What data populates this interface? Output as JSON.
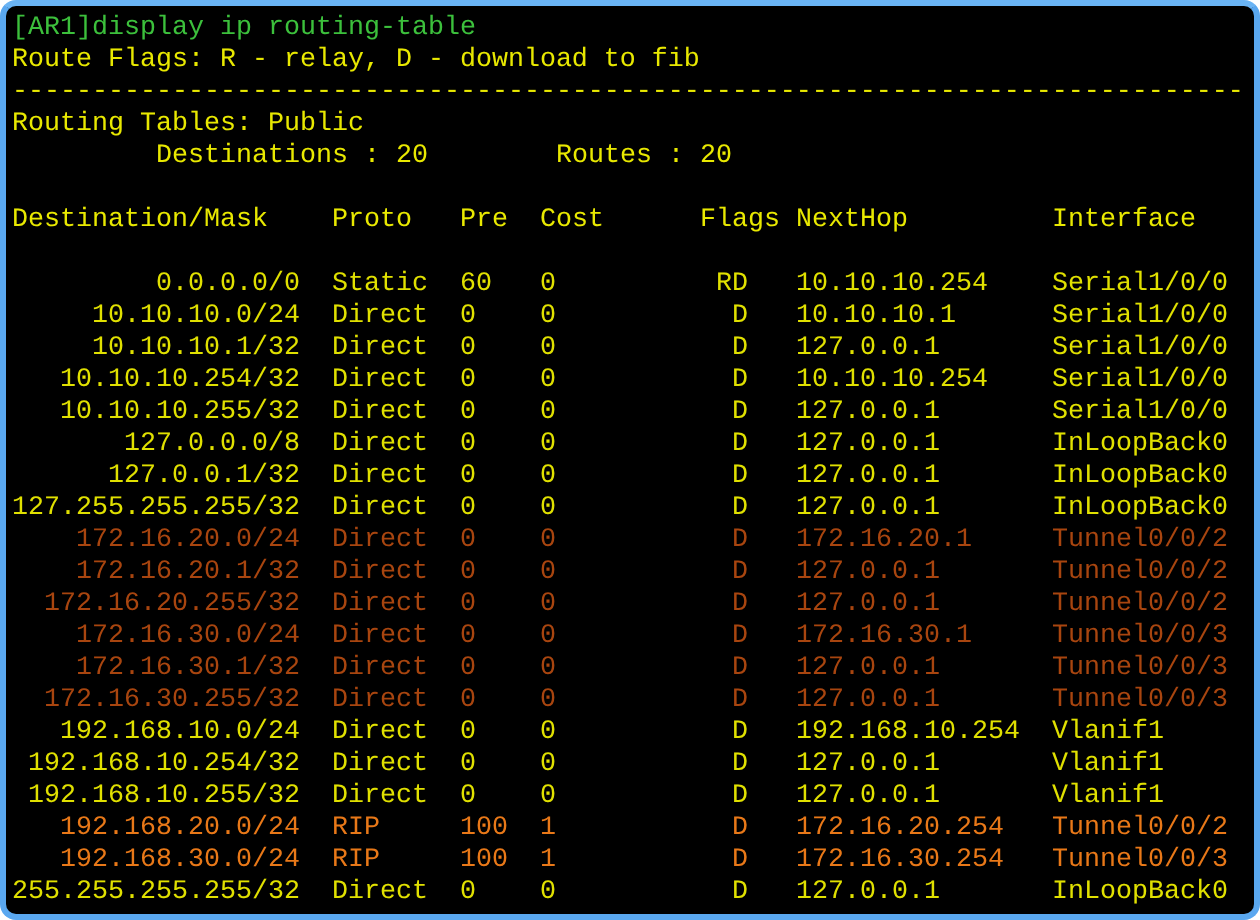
{
  "command": "[AR1]display ip routing-table",
  "flags_legend": "Route Flags: R - relay, D - download to fib",
  "separator": "-----------------------------------------------------------------------------",
  "table_name": "Routing Tables: Public",
  "summary": {
    "destinations": "Destinations : 20",
    "routes": "Routes : 20"
  },
  "columns": [
    "Destination/Mask",
    "Proto",
    "Pre",
    "Cost",
    "Flags",
    "NextHop",
    "Interface"
  ],
  "rows": [
    {
      "cells": [
        "0.0.0.0/0",
        "Static",
        "60",
        "0",
        "RD",
        "10.10.10.254",
        "Serial1/0/0"
      ],
      "color": "#e0e000"
    },
    {
      "cells": [
        "10.10.10.0/24",
        "Direct",
        "0",
        "0",
        "D",
        "10.10.10.1",
        "Serial1/0/0"
      ],
      "color": "#e0e000"
    },
    {
      "cells": [
        "10.10.10.1/32",
        "Direct",
        "0",
        "0",
        "D",
        "127.0.0.1",
        "Serial1/0/0"
      ],
      "color": "#e0e000"
    },
    {
      "cells": [
        "10.10.10.254/32",
        "Direct",
        "0",
        "0",
        "D",
        "10.10.10.254",
        "Serial1/0/0"
      ],
      "color": "#e0e000"
    },
    {
      "cells": [
        "10.10.10.255/32",
        "Direct",
        "0",
        "0",
        "D",
        "127.0.0.1",
        "Serial1/0/0"
      ],
      "color": "#e0e000"
    },
    {
      "cells": [
        "127.0.0.0/8",
        "Direct",
        "0",
        "0",
        "D",
        "127.0.0.1",
        "InLoopBack0"
      ],
      "color": "#e0e000"
    },
    {
      "cells": [
        "127.0.0.1/32",
        "Direct",
        "0",
        "0",
        "D",
        "127.0.0.1",
        "InLoopBack0"
      ],
      "color": "#e0e000"
    },
    {
      "cells": [
        "127.255.255.255/32",
        "Direct",
        "0",
        "0",
        "D",
        "127.0.0.1",
        "InLoopBack0"
      ],
      "color": "#e0e000"
    },
    {
      "cells": [
        "172.16.20.0/24",
        "Direct",
        "0",
        "0",
        "D",
        "172.16.20.1",
        "Tunnel0/0/2"
      ],
      "color": "#a8450f"
    },
    {
      "cells": [
        "172.16.20.1/32",
        "Direct",
        "0",
        "0",
        "D",
        "127.0.0.1",
        "Tunnel0/0/2"
      ],
      "color": "#a8450f"
    },
    {
      "cells": [
        "172.16.20.255/32",
        "Direct",
        "0",
        "0",
        "D",
        "127.0.0.1",
        "Tunnel0/0/2"
      ],
      "color": "#a8450f"
    },
    {
      "cells": [
        "172.16.30.0/24",
        "Direct",
        "0",
        "0",
        "D",
        "172.16.30.1",
        "Tunnel0/0/3"
      ],
      "color": "#a8450f"
    },
    {
      "cells": [
        "172.16.30.1/32",
        "Direct",
        "0",
        "0",
        "D",
        "127.0.0.1",
        "Tunnel0/0/3"
      ],
      "color": "#a8450f"
    },
    {
      "cells": [
        "172.16.30.255/32",
        "Direct",
        "0",
        "0",
        "D",
        "127.0.0.1",
        "Tunnel0/0/3"
      ],
      "color": "#a8450f"
    },
    {
      "cells": [
        "192.168.10.0/24",
        "Direct",
        "0",
        "0",
        "D",
        "192.168.10.254",
        "Vlanif1"
      ],
      "color": "#e0e000"
    },
    {
      "cells": [
        "192.168.10.254/32",
        "Direct",
        "0",
        "0",
        "D",
        "127.0.0.1",
        "Vlanif1"
      ],
      "color": "#e0e000"
    },
    {
      "cells": [
        "192.168.10.255/32",
        "Direct",
        "0",
        "0",
        "D",
        "127.0.0.1",
        "Vlanif1"
      ],
      "color": "#e0e000"
    },
    {
      "cells": [
        "192.168.20.0/24",
        "RIP",
        "100",
        "1",
        "D",
        "172.16.20.254",
        "Tunnel0/0/2"
      ],
      "color": "#e87818"
    },
    {
      "cells": [
        "192.168.30.0/24",
        "RIP",
        "100",
        "1",
        "D",
        "172.16.30.254",
        "Tunnel0/0/3"
      ],
      "color": "#e87818"
    },
    {
      "cells": [
        "255.255.255.255/32",
        "Direct",
        "0",
        "0",
        "D",
        "127.0.0.1",
        "InLoopBack0"
      ],
      "color": "#e0e000"
    }
  ]
}
